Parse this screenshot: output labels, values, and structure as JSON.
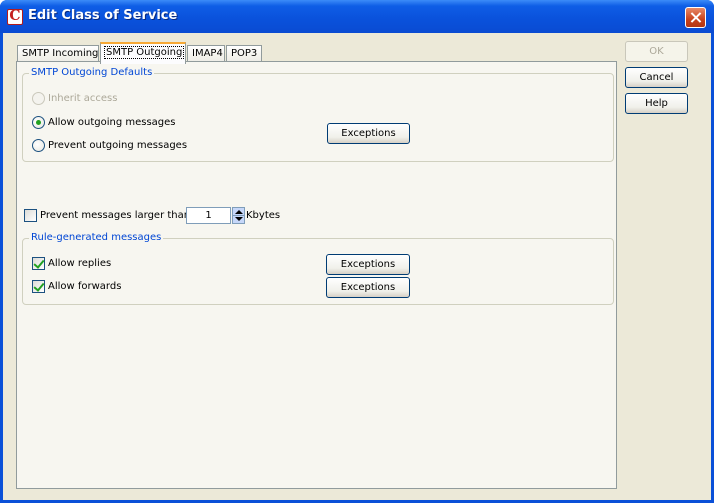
{
  "window": {
    "title": "Edit Class of Service"
  },
  "tabs": [
    {
      "label": "SMTP Incoming"
    },
    {
      "label": "SMTP Outgoing"
    },
    {
      "label": "IMAP4"
    },
    {
      "label": "POP3"
    }
  ],
  "active_tab": "SMTP Outgoing",
  "outgoing_defaults": {
    "title": "SMTP Outgoing Defaults",
    "inherit_label": "Inherit access",
    "allow_label": "Allow outgoing messages",
    "prevent_label": "Prevent outgoing messages",
    "selected": "Allow outgoing messages",
    "exceptions_label": "Exceptions"
  },
  "size_limit": {
    "label": "Prevent messages larger than",
    "checked": false,
    "value": "1",
    "unit": "Kbytes"
  },
  "rule_generated": {
    "title": "Rule-generated messages",
    "replies_label": "Allow replies",
    "replies_checked": true,
    "forwards_label": "Allow forwards",
    "forwards_checked": true,
    "exceptions_label": "Exceptions"
  },
  "buttons": {
    "ok": "OK",
    "cancel": "Cancel",
    "help": "Help"
  },
  "colors": {
    "titlebar": "#0a52dc",
    "group_title": "#0046d5",
    "check_mark": "#21a121",
    "close": "#c8421c"
  }
}
